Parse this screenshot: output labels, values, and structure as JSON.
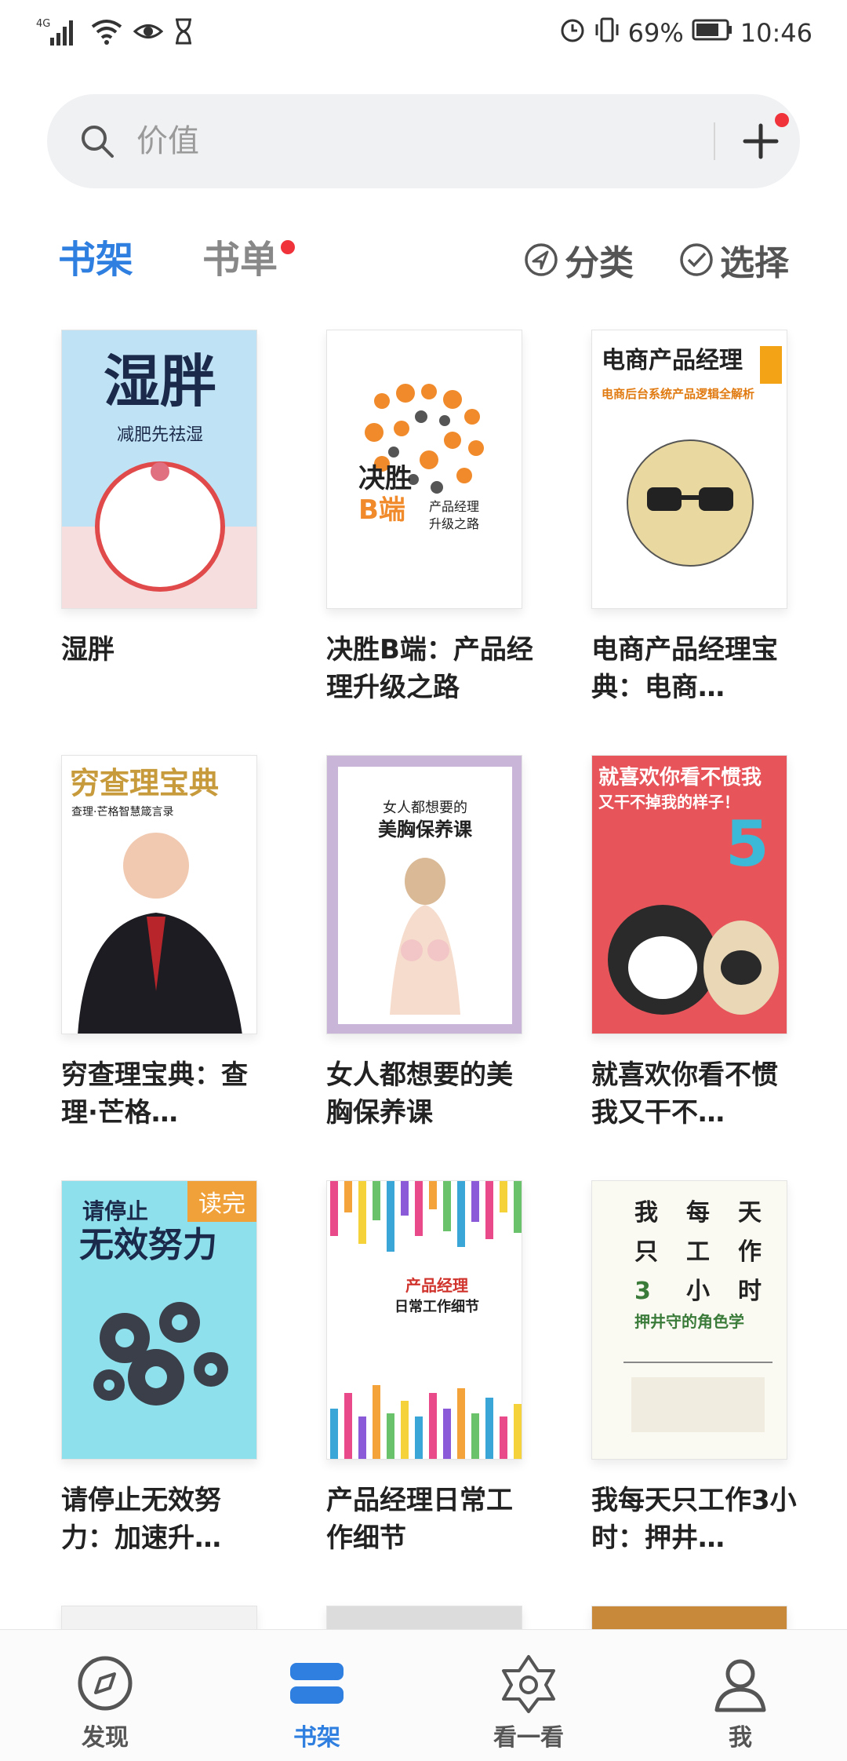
{
  "status_bar": {
    "network": "4G",
    "battery": "69%",
    "time": "10:46"
  },
  "search": {
    "placeholder": "价值"
  },
  "tabs": {
    "shelf": "书架",
    "booklist": "书单",
    "category": "分类",
    "select": "选择"
  },
  "books": [
    {
      "title": "湿胖",
      "cover_title": "湿胖",
      "cover_sub": "减肥先祛湿"
    },
    {
      "title": "决胜B端：产品经理升级之路",
      "cover_title": "决胜B端",
      "cover_sub": "产品经理升级之路"
    },
    {
      "title": "电商产品经理宝典：电商…",
      "cover_title": "电商产品经理宝典",
      "cover_sub": "电商后台系统产品逻辑全解析"
    },
    {
      "title": "穷查理宝典：查理·芒格…",
      "cover_title": "穷查理宝典",
      "cover_sub": "查理·芒格智慧箴言录"
    },
    {
      "title": "女人都想要的美胸保养课",
      "cover_title": "女人都想要的",
      "cover_sub": "美胸保养课"
    },
    {
      "title": "就喜欢你看不惯我又干不…",
      "cover_title": "就喜欢你看不惯我",
      "cover_sub": "又干不掉我的样子！"
    },
    {
      "title": "请停止无效努力：加速升…",
      "cover_title": "请停止",
      "cover_sub": "无效努力",
      "badge": "读完"
    },
    {
      "title": "产品经理日常工作细节",
      "cover_title": "产品经理",
      "cover_sub": "日常工作细节"
    },
    {
      "title": "我每天只工作3小时：押井…",
      "cover_title": "我每天只工作3小时",
      "cover_sub": "押井守的角色学"
    }
  ],
  "nav": {
    "discover": "发现",
    "shelf": "书架",
    "look": "看一看",
    "me": "我"
  },
  "colors": {
    "accent": "#2f7fe0",
    "notify": "#f0333a"
  }
}
